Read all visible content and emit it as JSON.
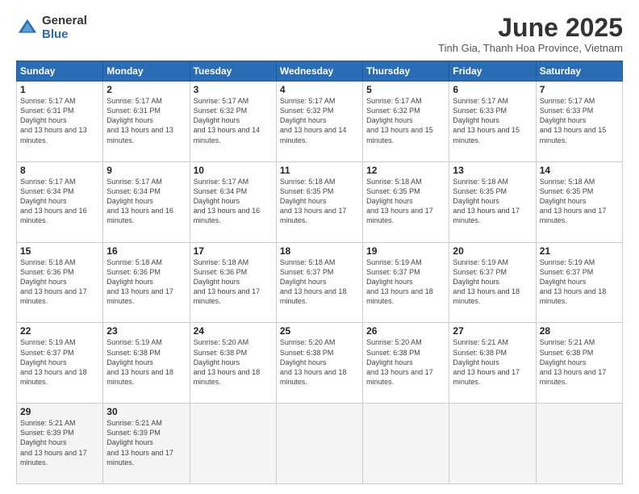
{
  "logo": {
    "general": "General",
    "blue": "Blue"
  },
  "title": "June 2025",
  "location": "Tinh Gia, Thanh Hoa Province, Vietnam",
  "days_header": [
    "Sunday",
    "Monday",
    "Tuesday",
    "Wednesday",
    "Thursday",
    "Friday",
    "Saturday"
  ],
  "weeks": [
    [
      {
        "num": "1",
        "rise": "5:17 AM",
        "set": "6:31 PM",
        "hours": "13 hours and 13 minutes."
      },
      {
        "num": "2",
        "rise": "5:17 AM",
        "set": "6:31 PM",
        "hours": "13 hours and 13 minutes."
      },
      {
        "num": "3",
        "rise": "5:17 AM",
        "set": "6:32 PM",
        "hours": "13 hours and 14 minutes."
      },
      {
        "num": "4",
        "rise": "5:17 AM",
        "set": "6:32 PM",
        "hours": "13 hours and 14 minutes."
      },
      {
        "num": "5",
        "rise": "5:17 AM",
        "set": "6:32 PM",
        "hours": "13 hours and 15 minutes."
      },
      {
        "num": "6",
        "rise": "5:17 AM",
        "set": "6:33 PM",
        "hours": "13 hours and 15 minutes."
      },
      {
        "num": "7",
        "rise": "5:17 AM",
        "set": "6:33 PM",
        "hours": "13 hours and 15 minutes."
      }
    ],
    [
      {
        "num": "8",
        "rise": "5:17 AM",
        "set": "6:34 PM",
        "hours": "13 hours and 16 minutes."
      },
      {
        "num": "9",
        "rise": "5:17 AM",
        "set": "6:34 PM",
        "hours": "13 hours and 16 minutes."
      },
      {
        "num": "10",
        "rise": "5:17 AM",
        "set": "6:34 PM",
        "hours": "13 hours and 16 minutes."
      },
      {
        "num": "11",
        "rise": "5:18 AM",
        "set": "6:35 PM",
        "hours": "13 hours and 17 minutes."
      },
      {
        "num": "12",
        "rise": "5:18 AM",
        "set": "6:35 PM",
        "hours": "13 hours and 17 minutes."
      },
      {
        "num": "13",
        "rise": "5:18 AM",
        "set": "6:35 PM",
        "hours": "13 hours and 17 minutes."
      },
      {
        "num": "14",
        "rise": "5:18 AM",
        "set": "6:35 PM",
        "hours": "13 hours and 17 minutes."
      }
    ],
    [
      {
        "num": "15",
        "rise": "5:18 AM",
        "set": "6:36 PM",
        "hours": "13 hours and 17 minutes."
      },
      {
        "num": "16",
        "rise": "5:18 AM",
        "set": "6:36 PM",
        "hours": "13 hours and 17 minutes."
      },
      {
        "num": "17",
        "rise": "5:18 AM",
        "set": "6:36 PM",
        "hours": "13 hours and 17 minutes."
      },
      {
        "num": "18",
        "rise": "5:18 AM",
        "set": "6:37 PM",
        "hours": "13 hours and 18 minutes."
      },
      {
        "num": "19",
        "rise": "5:19 AM",
        "set": "6:37 PM",
        "hours": "13 hours and 18 minutes."
      },
      {
        "num": "20",
        "rise": "5:19 AM",
        "set": "6:37 PM",
        "hours": "13 hours and 18 minutes."
      },
      {
        "num": "21",
        "rise": "5:19 AM",
        "set": "6:37 PM",
        "hours": "13 hours and 18 minutes."
      }
    ],
    [
      {
        "num": "22",
        "rise": "5:19 AM",
        "set": "6:37 PM",
        "hours": "13 hours and 18 minutes."
      },
      {
        "num": "23",
        "rise": "5:19 AM",
        "set": "6:38 PM",
        "hours": "13 hours and 18 minutes."
      },
      {
        "num": "24",
        "rise": "5:20 AM",
        "set": "6:38 PM",
        "hours": "13 hours and 18 minutes."
      },
      {
        "num": "25",
        "rise": "5:20 AM",
        "set": "6:38 PM",
        "hours": "13 hours and 18 minutes."
      },
      {
        "num": "26",
        "rise": "5:20 AM",
        "set": "6:38 PM",
        "hours": "13 hours and 17 minutes."
      },
      {
        "num": "27",
        "rise": "5:21 AM",
        "set": "6:38 PM",
        "hours": "13 hours and 17 minutes."
      },
      {
        "num": "28",
        "rise": "5:21 AM",
        "set": "6:38 PM",
        "hours": "13 hours and 17 minutes."
      }
    ],
    [
      {
        "num": "29",
        "rise": "5:21 AM",
        "set": "6:39 PM",
        "hours": "13 hours and 17 minutes."
      },
      {
        "num": "30",
        "rise": "5:21 AM",
        "set": "6:39 PM",
        "hours": "13 hours and 17 minutes."
      },
      null,
      null,
      null,
      null,
      null
    ]
  ]
}
